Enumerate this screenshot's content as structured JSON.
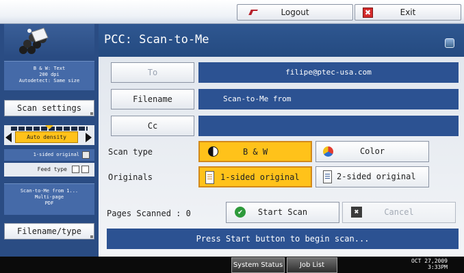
{
  "topbar": {
    "logout_label": "Logout",
    "exit_label": "Exit",
    "exit_icon_glyph": "✖"
  },
  "left_panel": {
    "scan_info_lines": [
      "B & W: Text",
      "200 dpi",
      "Autodetect: Same size"
    ],
    "scan_settings_label": "Scan settings",
    "density_label": "Auto density",
    "original_label": "1-sided original",
    "feed_type_label": "Feed type",
    "file_info_lines": [
      "Scan-to-Me from 1...",
      "Multi-page",
      "PDF"
    ],
    "filename_type_label": "Filename/type"
  },
  "header": {
    "title": "PCC: Scan-to-Me"
  },
  "form": {
    "to_label": "To",
    "to_value": "filipe@ptec-usa.com",
    "filename_label": "Filename",
    "filename_value": "Scan-to-Me from",
    "cc_label": "Cc",
    "cc_value": "",
    "scan_type_label": "Scan type",
    "scan_type_options": [
      {
        "label": "B & W",
        "selected": true,
        "icon": "bw-circle-icon"
      },
      {
        "label": "Color",
        "selected": false,
        "icon": "color-circle-icon"
      }
    ],
    "originals_label": "Originals",
    "originals_options": [
      {
        "label": "1-sided original",
        "selected": true,
        "icon": "one-sided-doc-icon"
      },
      {
        "label": "2-sided original",
        "selected": false,
        "icon": "two-sided-doc-icon"
      }
    ],
    "pages_scanned_label": "Pages Scanned : 0",
    "start_scan_label": "Start Scan",
    "check_glyph": "✔",
    "cancel_label": "Cancel",
    "x_glyph": "✖",
    "status_message": "Press Start button to begin scan..."
  },
  "bottombar": {
    "system_status_label": "System Status",
    "job_list_label": "Job List",
    "date": "OCT  27,2009",
    "time": "3:33PM"
  },
  "colors": {
    "selected": "#ffc21a",
    "field_blue": "#2c5292",
    "panel_blue": "#2a4c83"
  }
}
